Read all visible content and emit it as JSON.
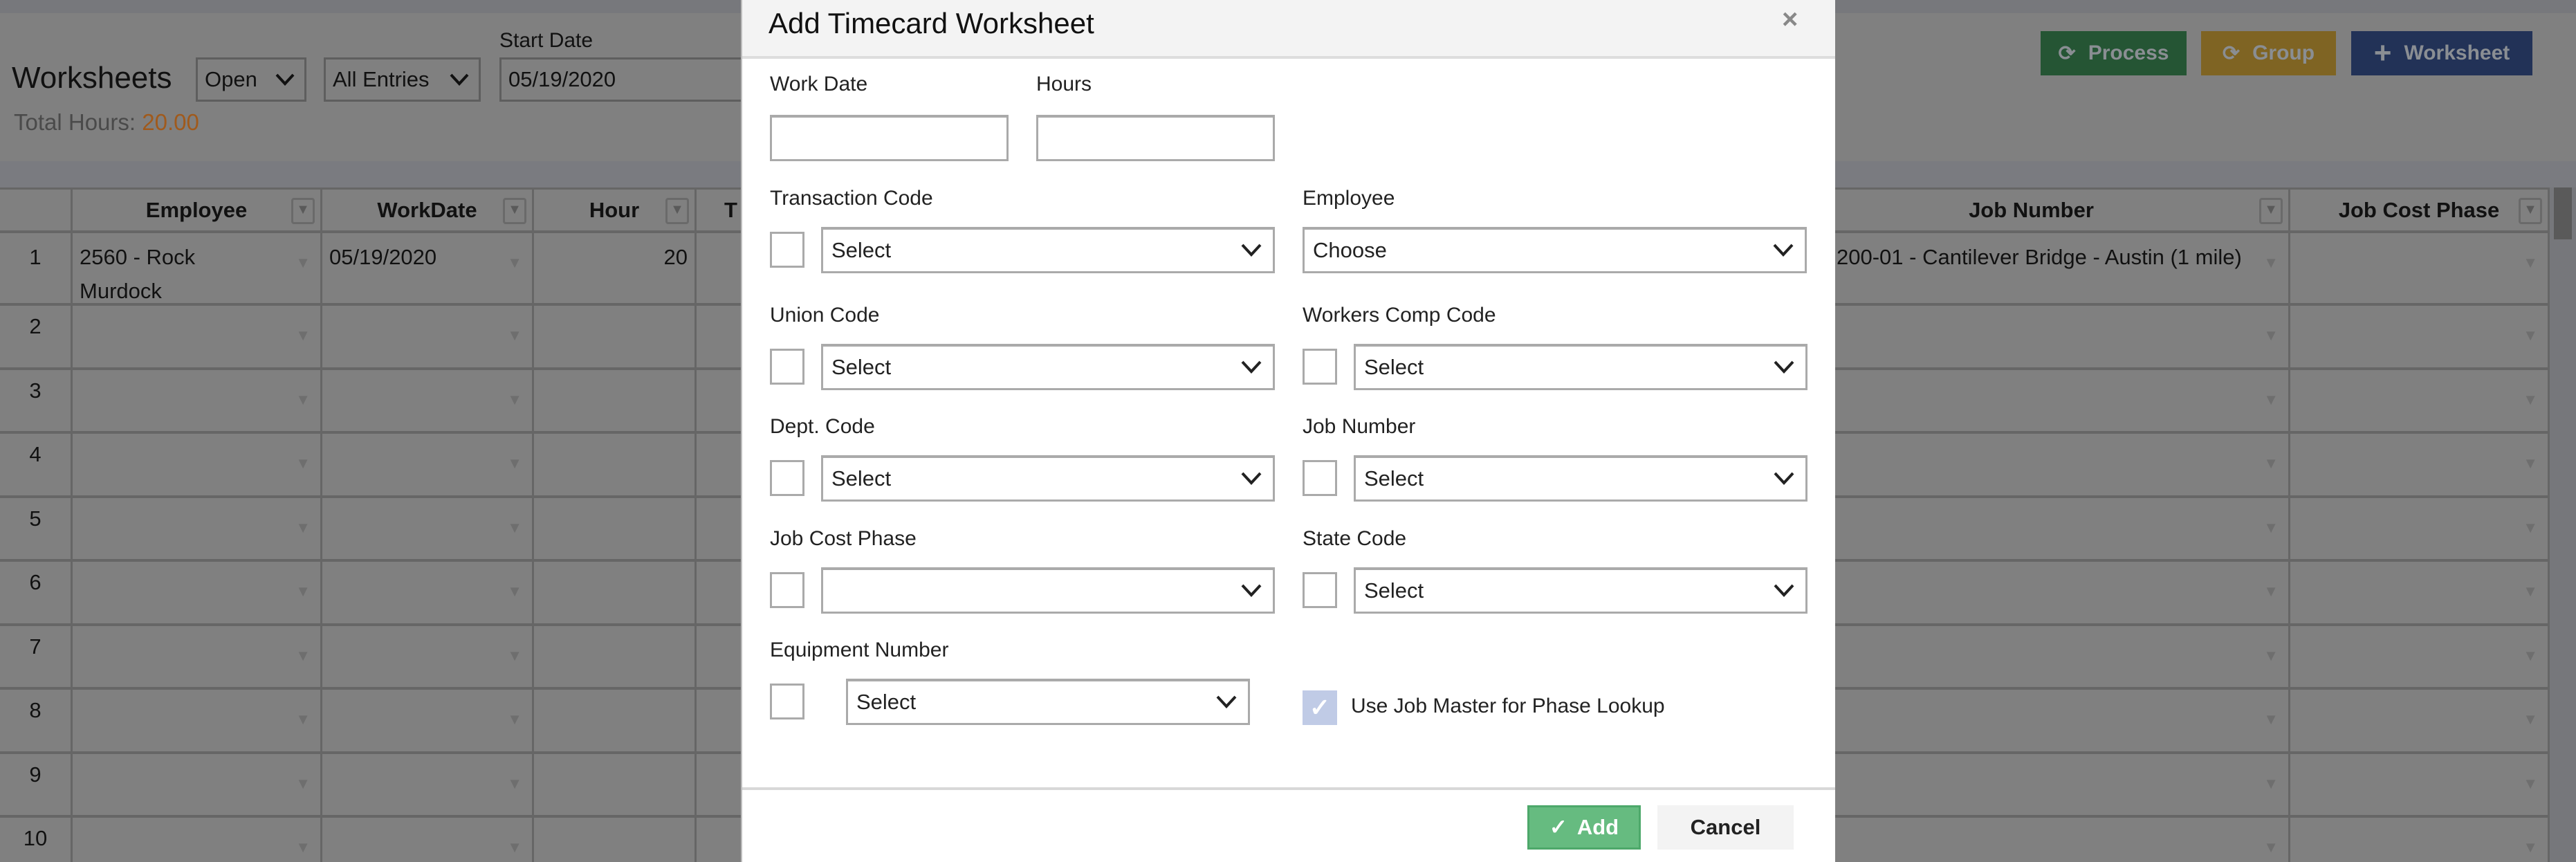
{
  "page": {
    "title": "Worksheets",
    "status_filter": "Open",
    "entries_filter": "All Entries",
    "start_date_label": "Start Date",
    "start_date_value": "05/19/2020",
    "total_hours_label": "Total Hours:",
    "total_hours_value": "20.00",
    "buttons": {
      "process": "Process",
      "group": "Group",
      "worksheet": "Worksheet"
    },
    "colors": {
      "process": "#255534",
      "group": "#7f6423",
      "worksheet": "#223257",
      "total_hours": "#a05a1c"
    }
  },
  "table": {
    "columns": [
      "",
      "Employee",
      "WorkDate",
      "Hour",
      "T",
      "Job Number",
      "Job Cost Phase"
    ],
    "rows": [
      {
        "num": "1",
        "employee": "2560 - Rock Murdock",
        "workdate": "05/19/2020",
        "hour": "20",
        "job_number": "200-01 - Cantilever Bridge - Austin (1 mile)",
        "job_cost_phase": ""
      },
      {
        "num": "2"
      },
      {
        "num": "3"
      },
      {
        "num": "4"
      },
      {
        "num": "5"
      },
      {
        "num": "6"
      },
      {
        "num": "7"
      },
      {
        "num": "8"
      },
      {
        "num": "9"
      },
      {
        "num": "10"
      }
    ]
  },
  "modal": {
    "title": "Add Timecard Worksheet",
    "close_icon": "×",
    "work_date_label": "Work Date",
    "work_date_value": "",
    "hours_label": "Hours",
    "hours_value": "",
    "transaction_code": {
      "label": "Transaction Code",
      "value": "Select"
    },
    "employee": {
      "label": "Employee",
      "value": "Choose"
    },
    "union_code": {
      "label": "Union Code",
      "value": "Select"
    },
    "workers_comp_code": {
      "label": "Workers Comp Code",
      "value": "Select"
    },
    "dept_code": {
      "label": "Dept. Code",
      "value": "Select"
    },
    "job_number": {
      "label": "Job Number",
      "value": "Select"
    },
    "job_cost_phase": {
      "label": "Job Cost Phase",
      "value": ""
    },
    "state_code": {
      "label": "State Code",
      "value": "Select"
    },
    "equipment_number": {
      "label": "Equipment Number",
      "value": "Select"
    },
    "use_job_master": {
      "label": "Use Job Master for Phase Lookup",
      "checked": true
    },
    "add_label": "Add",
    "cancel_label": "Cancel",
    "add_color": "#66bb80"
  }
}
